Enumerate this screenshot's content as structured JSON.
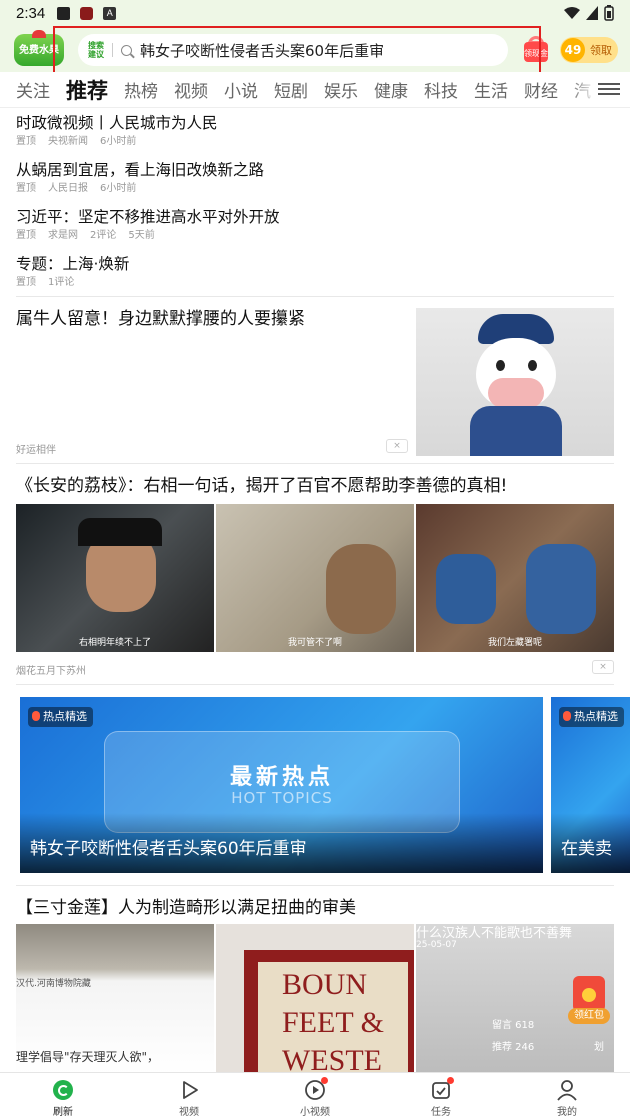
{
  "status_bar": {
    "time": "2:34",
    "notif_icon_a": "A"
  },
  "header": {
    "water_label": "免费水果",
    "search_tag": "搜索建议",
    "search_query": "韩女子咬断性侵者舌头案60年后重审",
    "gift_label": "领现金",
    "coin_count": "49",
    "claim_label": "领取"
  },
  "tabs": [
    "关注",
    "推荐",
    "热榜",
    "视频",
    "小说",
    "短剧",
    "娱乐",
    "健康",
    "科技",
    "生活",
    "财经",
    "汽"
  ],
  "active_tab_index": 1,
  "pinned": [
    {
      "title": "时政微视频丨人民城市为人民",
      "meta": [
        "置顶",
        "央视新闻",
        "6小时前"
      ]
    },
    {
      "title": "从蜗居到宜居，看上海旧改焕新之路",
      "meta": [
        "置顶",
        "人民日报",
        "6小时前"
      ]
    },
    {
      "title": "习近平：坚定不移推进高水平对外开放",
      "meta": [
        "置顶",
        "求是网",
        "2评论",
        "5天前"
      ]
    },
    {
      "title": "专题：上海·焕新",
      "meta": [
        "置顶",
        "1评论"
      ]
    }
  ],
  "ad_card": {
    "title": "属牛人留意！身边默默撑腰的人要攥紧",
    "source": "好运相伴",
    "close": "×"
  },
  "video_card": {
    "title": "《长安的荔枝》：右相一句话，揭开了百官不愿帮助李善德的真相!",
    "captions": [
      "右相明年续不上了",
      "我可管不了啊",
      "我们左藏署呢"
    ],
    "source": "烟花五月下苏州",
    "close": "×"
  },
  "hot_topics": {
    "badge": "热点精选",
    "banner_cn": "最新热点",
    "banner_en": "HOT TOPICS",
    "title": "韩女子咬断性侵者舌头案60年后重审",
    "next_title": "在美卖"
  },
  "article_card": {
    "title": "【三寸金莲】人为制造畸形以满足扭曲的审美",
    "thumb1_text": [
      "汉代.河南博物院藏",
      "理学倡导\"存天理灭人欲\"，"
    ],
    "thumb2_text": [
      "BOUN",
      "FEET &",
      "WESTE"
    ],
    "thumb3_text": [
      "什么汉族人不能歌也不善舞",
      "25-05-07",
      "留言 618",
      "推荐 246",
      "划"
    ]
  },
  "red_packet": {
    "label": "领红包"
  },
  "bottom_nav": [
    {
      "label": "刷新",
      "icon": "refresh-icon"
    },
    {
      "label": "视频",
      "icon": "play-icon"
    },
    {
      "label": "小视频",
      "icon": "short-video-icon"
    },
    {
      "label": "任务",
      "icon": "task-icon"
    },
    {
      "label": "我的",
      "icon": "profile-icon"
    }
  ],
  "colors": {
    "accent": "#22b24c",
    "header_bg": "#eef7e6",
    "highlight": "#e02020"
  }
}
